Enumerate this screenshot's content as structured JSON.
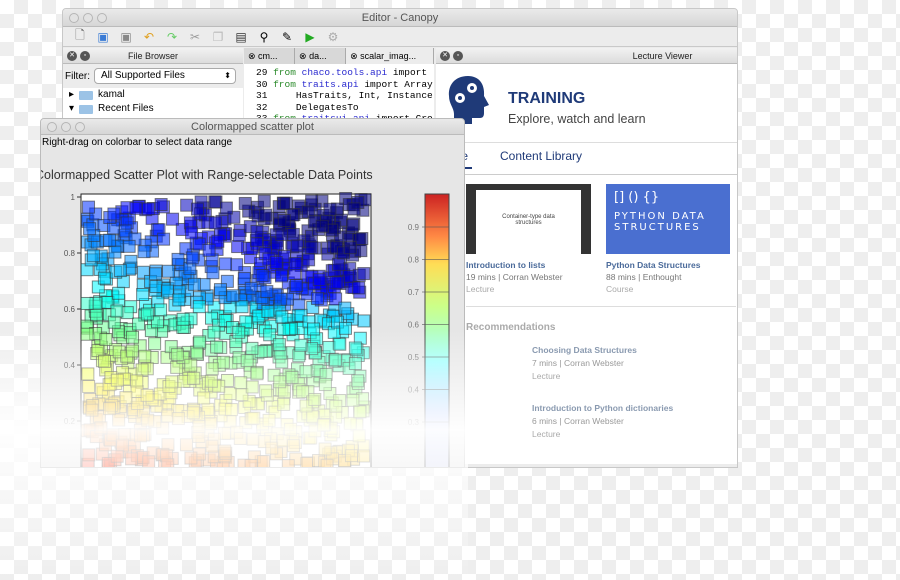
{
  "editor": {
    "title": "Editor - Canopy",
    "toolbar_icons": [
      "new-file-icon",
      "save-icon",
      "save-all-icon",
      "undo-icon",
      "redo-icon",
      "cut-icon",
      "copy-icon",
      "paste-icon",
      "find-icon",
      "find-replace-icon",
      "run-icon",
      "debug-icon"
    ],
    "file_browser": {
      "title": "File Browser",
      "filter_label": "Filter:",
      "filter_value": "All Supported Files",
      "items": [
        "kamal",
        "Recent Files"
      ]
    },
    "tabs": [
      "cm...",
      "da...",
      "scalar_imag..."
    ],
    "code": [
      {
        "n": "29",
        "a": "from ",
        "b": "chaco.tools.api",
        "c": " import"
      },
      {
        "n": "30",
        "a": "from ",
        "b": "traits.api",
        "c": " import Array"
      },
      {
        "n": "31",
        "a": "",
        "b": "",
        "c": "    HasTraits, Int, Instance"
      },
      {
        "n": "32",
        "a": "",
        "b": "",
        "c": "    DelegatesTo"
      },
      {
        "n": "33",
        "a": "from ",
        "b": "traitsui.api",
        "c": " import Gro"
      }
    ]
  },
  "lecture": {
    "title": "Lecture Viewer",
    "brand": "TRAINING",
    "tagline": "Explore, watch and learn",
    "nav": [
      "Home",
      "Content Library"
    ],
    "cards": [
      {
        "thumb": "Container-type data structures",
        "title": "Introduction to lists",
        "meta": "19 mins | Corran Webster",
        "type": "Lecture"
      },
      {
        "thumb": "[]  ()  {}",
        "thumb2": "Python Data Structures",
        "title": "Python Data Structures",
        "meta": "88 mins | Enthought",
        "type": "Course"
      }
    ],
    "recommendations_title": "Recommendations",
    "recommendations": [
      {
        "title": "Choosing Data Structures",
        "meta": "7 mins | Corran Webster",
        "type": "Lecture"
      },
      {
        "title": "Introduction to Python dictionaries",
        "meta": "6 mins | Corran Webster",
        "type": "Lecture"
      }
    ],
    "accent": "#1f3a78"
  },
  "scatter": {
    "title": "Colormapped scatter plot",
    "hint": "Right-drag on colorbar to select data range",
    "plot_title": "Colormapped Scatter Plot with Range-selectable Data Points",
    "y_ticks": [
      "1",
      "0.8",
      "0.6",
      "0.4",
      "0.2"
    ],
    "colorbar_ticks": [
      "0.9",
      "0.8",
      "0.7",
      "0.6",
      "0.5",
      "0.4",
      "0.3"
    ]
  }
}
